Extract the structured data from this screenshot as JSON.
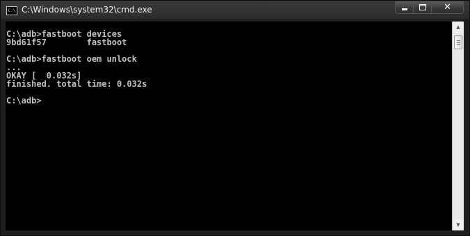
{
  "window": {
    "title": "C:\\Windows\\system32\\cmd.exe",
    "icon_text": "C:\\"
  },
  "controls": {
    "minimize_icon": "minimize-icon",
    "maximize_icon": "maximize-icon",
    "close_icon": "close-icon"
  },
  "terminal": {
    "lines": [
      "C:\\adb>fastboot devices",
      "9bd61f57        fastboot",
      "",
      "C:\\adb>fastboot oem unlock",
      "...",
      "OKAY [  0.032s]",
      "finished. total time: 0.032s",
      "",
      "C:\\adb>"
    ]
  }
}
